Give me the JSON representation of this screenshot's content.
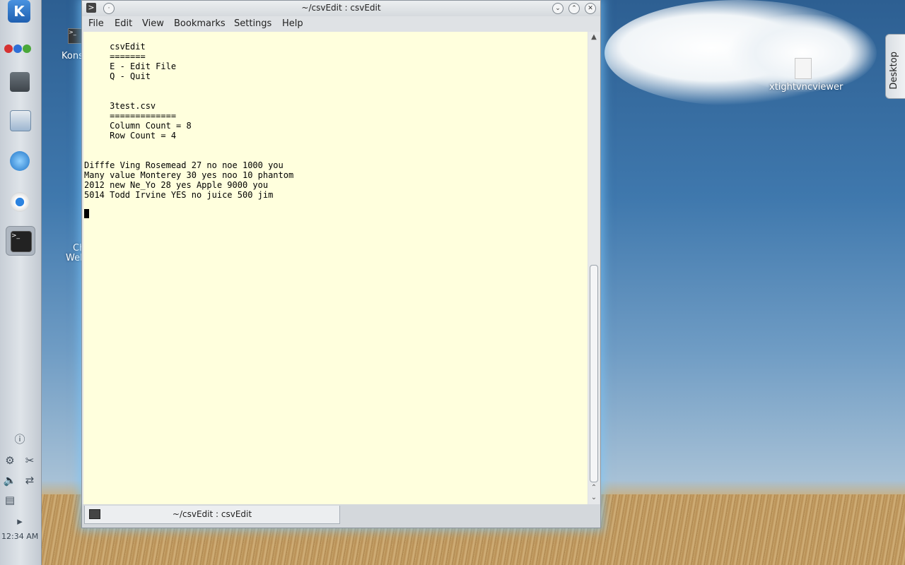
{
  "window": {
    "title": "~/csvEdit : csvEdit",
    "menus": [
      "File",
      "Edit",
      "View",
      "Bookmarks",
      "Settings",
      "Help"
    ]
  },
  "terminal": {
    "lines": [
      "     csvEdit",
      "     =======",
      "     E - Edit File",
      "     Q - Quit",
      "",
      "",
      "     3test.csv",
      "     =============",
      "     Column Count = 8",
      "     Row Count = 4",
      "",
      "",
      "Difffe Ving Rosemead 27 no noe 1000 you",
      "Many value Monterey 30 yes noo 10 phantom",
      "2012 new Ne_Yo 28 yes Apple 9000 you",
      "5014 Todd Irvine YES no juice 500 jim"
    ],
    "background": "#ffffdd"
  },
  "tab": {
    "label": "~/csvEdit : csvEdit"
  },
  "desktop": {
    "icons": [
      {
        "label": "Kons",
        "icon": "terminal-icon"
      },
      {
        "label": "Ch",
        "icon": "chrome-icon"
      },
      {
        "label": "Web",
        "icon": "chrome-icon"
      },
      {
        "label": "xtightvncviewer",
        "icon": "file-icon"
      }
    ],
    "side_tab": "Desktop"
  },
  "panel": {
    "clock": "12:34 AM",
    "launchers": [
      "kde-menu-icon",
      "activities-icon",
      "desktop-icon",
      "file-manager-icon",
      "browser-icon",
      "chrome-icon",
      "terminal-icon"
    ]
  }
}
